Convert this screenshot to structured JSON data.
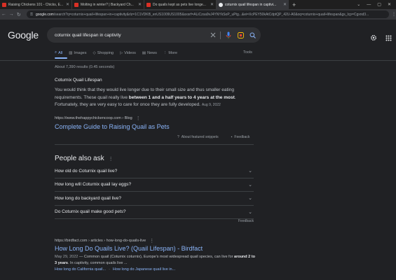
{
  "browser": {
    "tabs": [
      {
        "title": "Raising Chickens 101 - Chicks, E...",
        "favicon_color": "#d93025",
        "active": false
      },
      {
        "title": "Molting in winter? | Backyard Ch...",
        "favicon_color": "#d93025",
        "active": false
      },
      {
        "title": "Do quails kept as pets live longe...",
        "favicon_color": "#d93025",
        "active": false
      },
      {
        "title": "coturnix quail lifespan in captivi...",
        "favicon_color": "#e8eaed",
        "active": true
      }
    ],
    "new_tab": "+",
    "address": {
      "host": "google.com",
      "path": "/search?q=coturnix+quail+lifespan+in+captivity&rlz=1C1VDKB_enUS1009US1005&sxsrf=ALiCzsa9vJ4YNYkSoP_uPtg...&ei=XcPEY50kAtCdptQP_42U-A0&oq=coturnix+quail+lifespan&gs_lcp=Cgxnd3..."
    }
  },
  "google": {
    "logo": "Google",
    "query": "coturnix quail lifespan in captivity",
    "nav": [
      {
        "label": "All",
        "icon": "search-icon",
        "active": true
      },
      {
        "label": "Images",
        "icon": "image-icon",
        "active": false
      },
      {
        "label": "Shopping",
        "icon": "tag-icon",
        "active": false
      },
      {
        "label": "Videos",
        "icon": "video-icon",
        "active": false
      },
      {
        "label": "News",
        "icon": "news-icon",
        "active": false
      },
      {
        "label": "More",
        "icon": "more-vert-icon",
        "active": false
      }
    ],
    "tools": "Tools",
    "stats": "About 7,390 results (0.45 seconds)"
  },
  "featured_snippet": {
    "title": "Coturnix Quail Lifespan",
    "text_a": "You would think that they would live longer due to their small size and thus smaller eating requirements. These quail really live ",
    "text_bold": "between 1 and a half years to 4 years at the most",
    "text_b": ". Fortunately, they are very easy to care for once they are fully developed.",
    "date": "Aug 9, 2022",
    "url": "https://www.thehappychickencoop.com › Blog",
    "link": "Complete Guide to Raising Quail as Pets",
    "about": "About featured snippets",
    "feedback": "Feedback"
  },
  "people_also_ask": {
    "title": "People also ask",
    "questions": [
      "How old do Coturnix quail live?",
      "How long will Coturnix quail lay eggs?",
      "How long do backyard quail live?",
      "Do Coturnix quail make good pets?"
    ],
    "feedback": "Feedback"
  },
  "result2": {
    "url": "https://birdfact.com › articles › how-long-do-quails-live",
    "title": "How Long Do Quails Live? (Quail Lifespan) - Birdfact",
    "date": "May 29, 2022",
    "snip_a": " — Common quail (Coturnix coturnix), Europe's most widespread quail species, can live for ",
    "snip_bold": "around 2 to 3 years",
    "snip_b": ". In captivity, common quails live ...",
    "sitelinks": [
      "How long do California quail...",
      "How long do Japanese quail live in..."
    ]
  },
  "colors": {
    "background": "#202124",
    "link": "#8ab4f8",
    "text": "#bdc1c6"
  }
}
